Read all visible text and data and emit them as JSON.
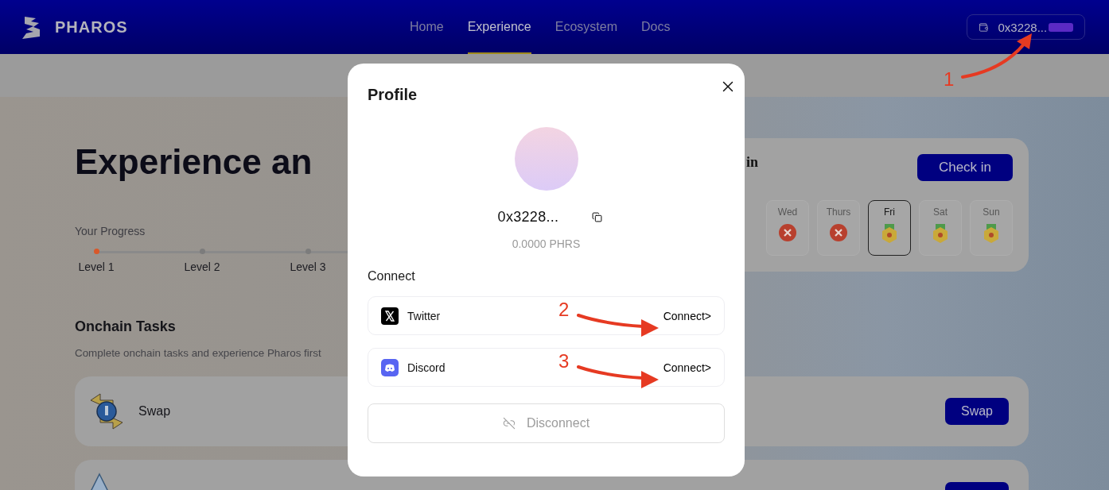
{
  "header": {
    "brand": "PHAROS",
    "nav": [
      {
        "label": "Home",
        "selected": false
      },
      {
        "label": "Experience",
        "selected": true
      },
      {
        "label": "Ecosystem",
        "selected": false
      },
      {
        "label": "Docs",
        "selected": false
      }
    ],
    "wallet": "0x3228..."
  },
  "hero": {
    "title": "Experience an"
  },
  "progress": {
    "label": "Your Progress",
    "levels": [
      {
        "label": "Level 1",
        "selected": true
      },
      {
        "label": "Level 2",
        "selected": false
      },
      {
        "label": "Level 3",
        "selected": false
      }
    ]
  },
  "checkin": {
    "title": "in",
    "button": "Check in",
    "days": [
      {
        "label": "Wed",
        "kind": "missed",
        "selected": false
      },
      {
        "label": "Thurs",
        "kind": "missed",
        "selected": false
      },
      {
        "label": "Fri",
        "kind": "reward",
        "selected": true
      },
      {
        "label": "Sat",
        "kind": "reward",
        "selected": false
      },
      {
        "label": "Sun",
        "kind": "reward",
        "selected": false
      }
    ]
  },
  "tasks": {
    "title": "Onchain Tasks",
    "description": "Complete onchain tasks and experience Pharos first",
    "items": [
      {
        "kind": "swap",
        "name": "Swap",
        "button": "Swap"
      },
      {
        "kind": "pyramid"
      }
    ]
  },
  "modal": {
    "title": "Profile",
    "address": "0x3228...",
    "balance": "0.0000 PHRS",
    "connect_label": "Connect",
    "accounts": [
      {
        "kind": "twitter",
        "name": "Twitter",
        "action": "Connect>"
      },
      {
        "kind": "discord",
        "name": "Discord",
        "action": "Connect>"
      }
    ],
    "disconnect": "Disconnect"
  },
  "annotations": [
    {
      "label": "1"
    },
    {
      "label": "2"
    },
    {
      "label": "3"
    }
  ]
}
